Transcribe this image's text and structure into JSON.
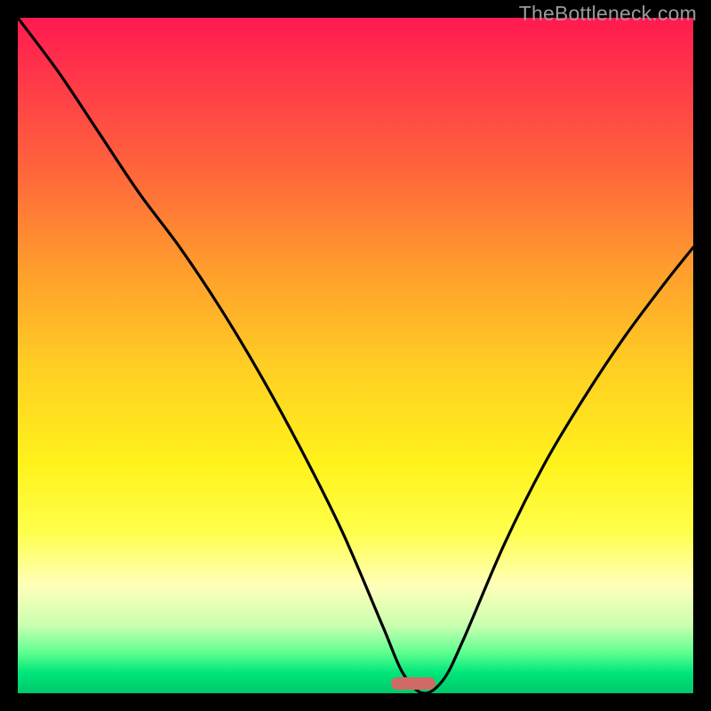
{
  "watermark": "TheBottleneck.com",
  "chart_data": {
    "type": "line",
    "title": "",
    "xlabel": "",
    "ylabel": "",
    "xlim": [
      0,
      100
    ],
    "ylim": [
      0,
      100
    ],
    "x": [
      0,
      6,
      12,
      18,
      24,
      30,
      36,
      42,
      48,
      54,
      57,
      60,
      63,
      66,
      72,
      78,
      84,
      90,
      96,
      100
    ],
    "values": [
      100,
      92,
      83,
      74,
      66,
      57,
      47,
      36,
      24,
      10,
      3,
      0,
      2,
      8,
      22,
      34,
      44,
      53,
      61,
      66
    ],
    "marker": {
      "x": 58.5,
      "y": 1.5
    },
    "gradient_stops": [
      {
        "pos": 0,
        "color": "#ff1a50"
      },
      {
        "pos": 24,
        "color": "#ff6a3a"
      },
      {
        "pos": 52,
        "color": "#ffcf23"
      },
      {
        "pos": 76,
        "color": "#ffff4a"
      },
      {
        "pos": 94,
        "color": "#5eff90"
      },
      {
        "pos": 100,
        "color": "#00c86b"
      }
    ]
  }
}
